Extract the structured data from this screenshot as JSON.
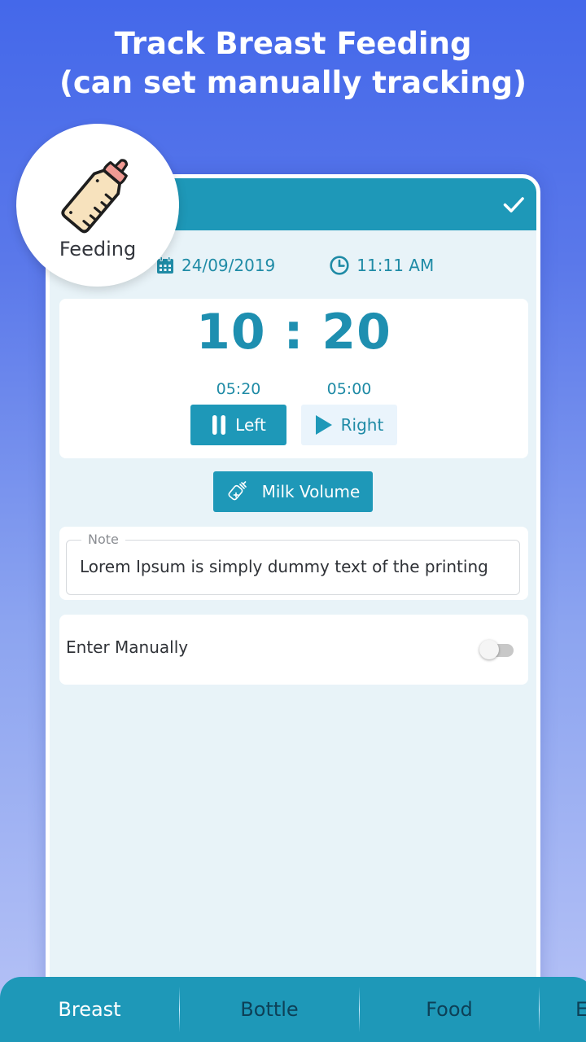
{
  "promo": {
    "title_line1": "Track Breast Feeding",
    "title_line2": "(can set manually tracking)"
  },
  "badge": {
    "icon": "baby-bottle-icon",
    "label": "Feeding"
  },
  "header": {
    "confirm_icon": "check-icon"
  },
  "datetime": {
    "date_icon": "calendar-icon",
    "date": "24/09/2019",
    "time_icon": "clock-icon",
    "time": "11:11 AM"
  },
  "timer": {
    "total": "10 : 20",
    "left": {
      "time": "05:20",
      "label": "Left",
      "icon": "pause-icon",
      "state": "active"
    },
    "right": {
      "time": "05:00",
      "label": "Right",
      "icon": "play-icon",
      "state": "inactive"
    }
  },
  "milk_volume": {
    "icon": "bottle-plus-icon",
    "label": "Milk Volume"
  },
  "note": {
    "label": "Note",
    "value": "Lorem Ipsum is simply dummy text of the printing"
  },
  "manual": {
    "label": "Enter Manually",
    "enabled": false
  },
  "tabs": [
    {
      "label": "Breast",
      "active": true
    },
    {
      "label": "Bottle",
      "active": false
    },
    {
      "label": "Food",
      "active": false
    },
    {
      "label": "E",
      "active": false
    }
  ],
  "colors": {
    "primary": "#1e98b8",
    "background_top": "#4468ea",
    "background_bottom": "#b7c3f6",
    "panel": "#e8f3f8",
    "accent_text": "#1f8ba6"
  }
}
